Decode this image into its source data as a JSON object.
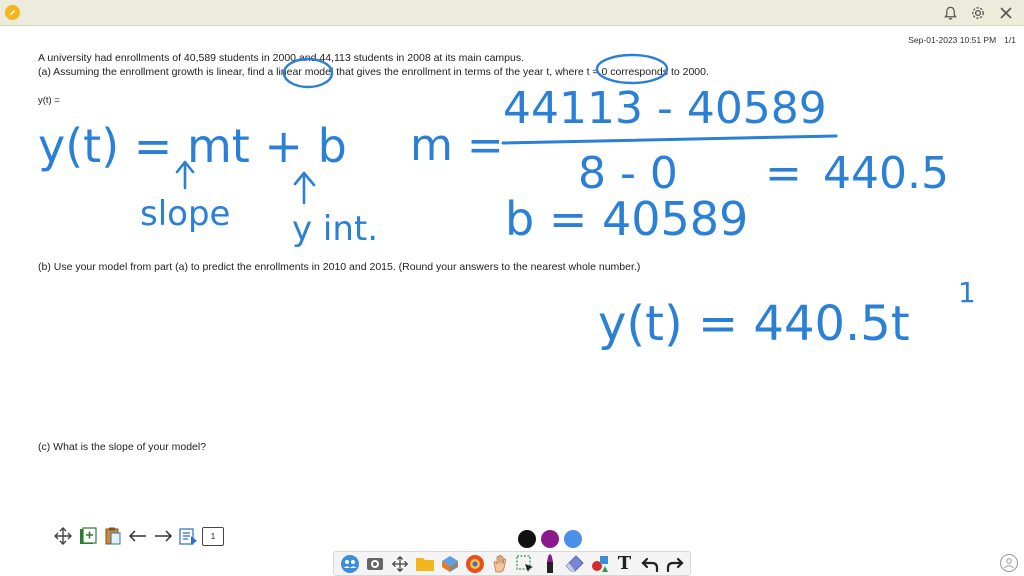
{
  "toolbar_top": {
    "icons": [
      "app-icon",
      "bell-icon",
      "gear-icon",
      "close-icon"
    ]
  },
  "page": {
    "timestamp": "Sep-01-2023 10:51 PM",
    "page_count": "1/1"
  },
  "question": {
    "intro": "A university had enrollments of 40,589 students in 2000 and 44,113 students in 2008 at its main campus.",
    "part_a": "(a) Assuming the enrollment growth is linear, find a linear model that gives the enrollment in terms of the year t, where t = 0 corresponds to 2000.",
    "answer_label": "y(t) =",
    "part_b": "(b) Use your model from part (a) to predict the enrollments in 2010 and 2015. (Round your answers to the nearest whole number.)",
    "part_c": "(c) What is the slope of your model?"
  },
  "handwriting": {
    "eq_model": "y(t) = mt + b",
    "arrow_label_slope": "slope",
    "arrow_label_yint": "y int.",
    "m_label": "m =",
    "m_numerator": "44113 - 40589",
    "m_denominator": "8 - 0",
    "m_equals": "=",
    "m_value": "440.5",
    "b_line": "b = 40589",
    "model_result": "y(t) = 440.5t",
    "stray_mark": "1",
    "ink_color": "#2a7fd6"
  },
  "bottom_nav": {
    "icons": [
      "move-icon",
      "add-page-icon",
      "clipboard-icon",
      "arrow-left-icon",
      "arrow-right-icon",
      "page-list-icon"
    ],
    "page_button": "1"
  },
  "palette": {
    "colors": [
      "#111111",
      "#8a1a8c",
      "#4a8fe8"
    ]
  },
  "draw_tools": {
    "icons": [
      "people-icon",
      "screenshot-icon",
      "move-icon",
      "folder-icon",
      "shapes-icon",
      "browser-icon",
      "hand-icon",
      "select-icon",
      "marker-icon",
      "eraser-icon",
      "shapes-palette-icon",
      "text-tool-icon",
      "undo-icon",
      "redo-icon"
    ],
    "text_tool_label": "T"
  }
}
